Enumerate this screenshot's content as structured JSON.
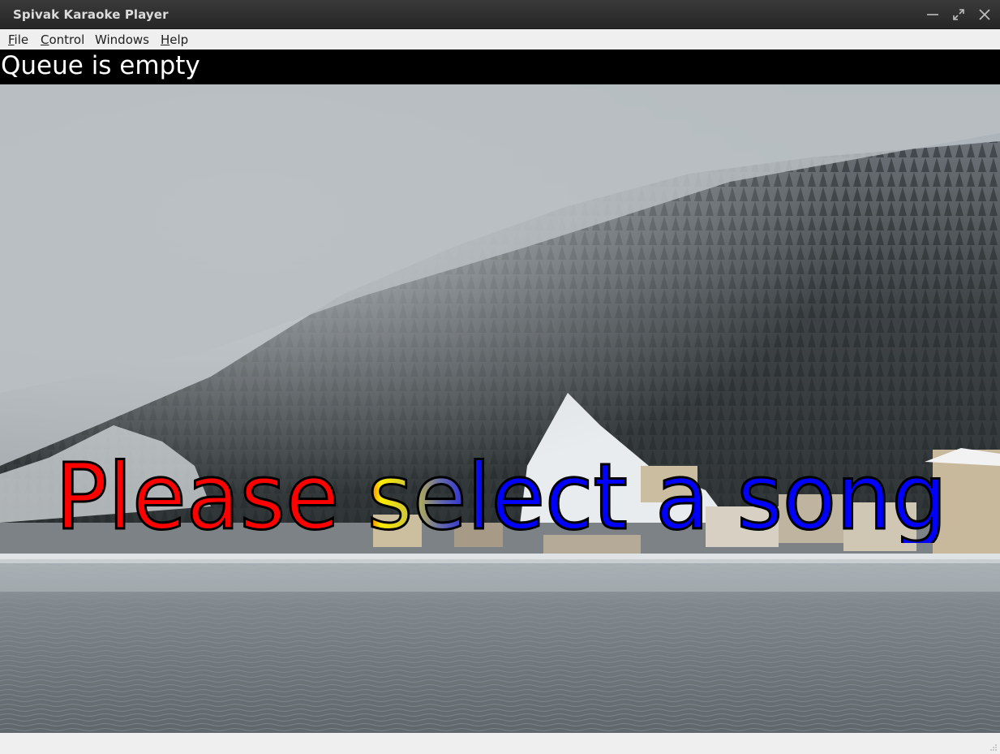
{
  "window": {
    "title": "Spivak Karaoke Player",
    "controls": [
      "minimize-icon",
      "maximize-icon",
      "close-icon"
    ]
  },
  "menu": {
    "file": {
      "mnemonic": "F",
      "rest": "ile"
    },
    "control": {
      "mnemonic": "C",
      "rest": "ontrol"
    },
    "windows": {
      "label": "Windows"
    },
    "help": {
      "mnemonic": "H",
      "rest": "elp"
    }
  },
  "queue": {
    "status": "Queue is empty"
  },
  "lyrics": {
    "text": "Please select a song",
    "sung_color": "#ff0000",
    "current_color": "#ffee00",
    "unsung_color": "#0000ff",
    "outline_color": "#000000"
  },
  "colors": {
    "titlebar": "#2e2e2e",
    "menubar": "#efefef",
    "queuebar": "#000000"
  }
}
